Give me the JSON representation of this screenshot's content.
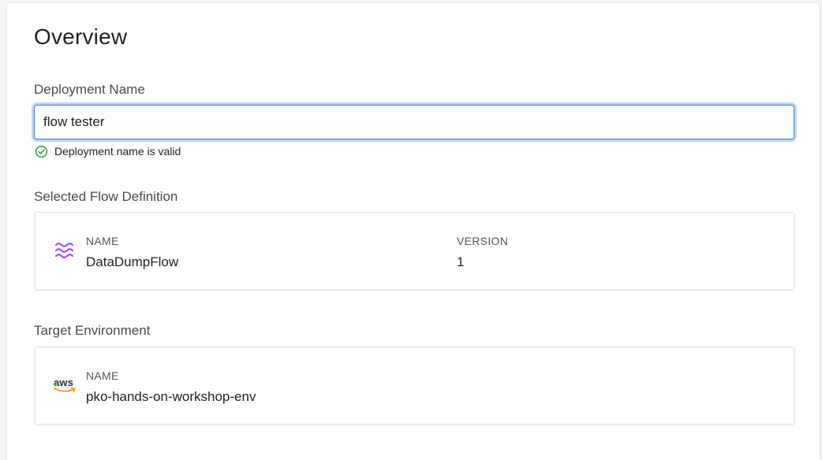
{
  "overview": {
    "title": "Overview"
  },
  "deployment": {
    "label": "Deployment Name",
    "value": "flow tester",
    "validation_message": "Deployment name is valid"
  },
  "flow_definition": {
    "section_label": "Selected Flow Definition",
    "icon": "wave-flow-icon",
    "name_caption": "NAME",
    "name": "DataDumpFlow",
    "version_caption": "VERSION",
    "version": "1"
  },
  "target_environment": {
    "section_label": "Target Environment",
    "icon": "aws-logo",
    "logo_text": "aws",
    "name_caption": "NAME",
    "name": "pko-hands-on-workshop-env"
  },
  "colors": {
    "focus_ring": "#3f7dd8",
    "valid_green": "#2e9a3e",
    "flow_icon_purple": "#a64dff",
    "aws_orange": "#ff9900"
  }
}
